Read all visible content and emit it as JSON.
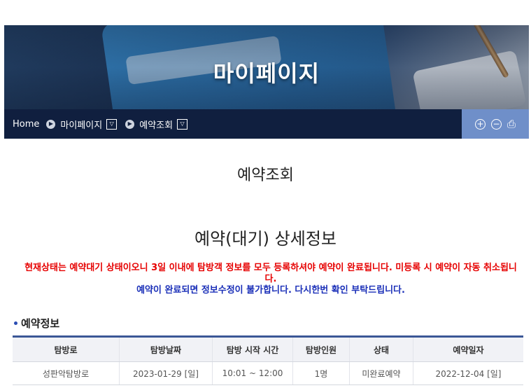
{
  "banner": {
    "title": "마이페이지"
  },
  "breadcrumb": {
    "home": "Home",
    "level1": "마이페이지",
    "level2": "예약조회",
    "separator_glyph": "▶",
    "dropdown_glyph": "▽"
  },
  "toolbar": {
    "zoom_in_glyph": "+",
    "zoom_out_glyph": "−",
    "print_glyph": "⎙",
    "accent_color": "#6f8fc9",
    "nav_color": "#101f3f"
  },
  "page": {
    "title": "예약조회",
    "section_title": "예약(대기) 상세정보",
    "notice_red": "현재상태는 예약대기 상태이오니 3일 이내에 탐방객 정보를 모두 등록하셔야 예약이 완료됩니다. 미등록 시 예약이 자동 취소됩니다.",
    "notice_blue": "예약이 완료되면 정보수정이 불가합니다. 다시한번 확인 부탁드립니다.",
    "notice_red_color": "#e60000",
    "notice_blue_color": "#1a2fb8"
  },
  "reservation": {
    "heading": "예약정보",
    "columns": [
      "탐방로",
      "탐방날짜",
      "탐방 시작 시간",
      "탐방인원",
      "상태",
      "예약일자"
    ],
    "rows": [
      [
        "성판악탐방로",
        "2023-01-29 [일]",
        "10:01 ~ 12:00",
        "1명",
        "미완료예약",
        "2022-12-04 [일]"
      ]
    ]
  }
}
